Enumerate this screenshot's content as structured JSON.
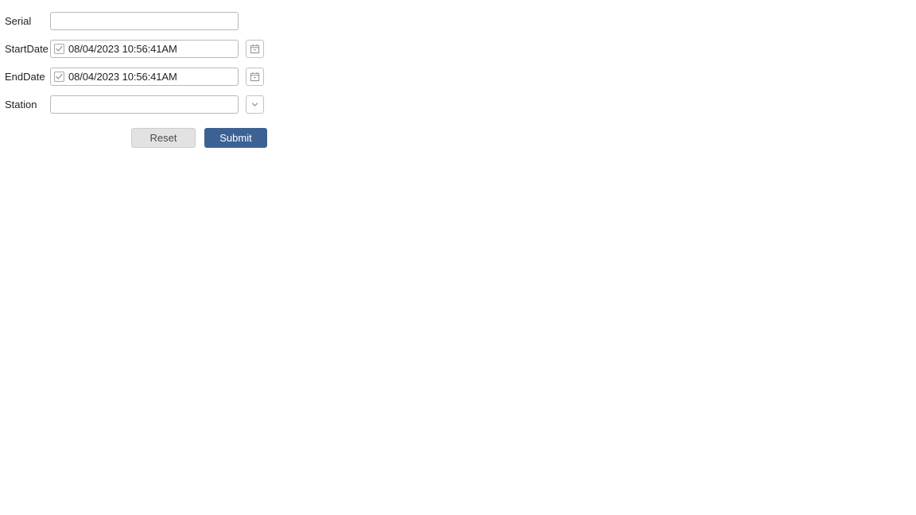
{
  "form": {
    "fields": [
      {
        "key": "serial",
        "label": "Serial",
        "type": "text",
        "value": "",
        "placeholder": ""
      },
      {
        "key": "startdate",
        "label": "StartDate",
        "type": "datetime",
        "value": "08/04/2023 10:56:41AM",
        "checked": true,
        "trailing_icon": "calendar-icon"
      },
      {
        "key": "enddate",
        "label": "EndDate",
        "type": "datetime",
        "value": "08/04/2023 10:56:41AM",
        "checked": true,
        "trailing_icon": "calendar-icon"
      },
      {
        "key": "station",
        "label": "Station",
        "type": "select",
        "value": "",
        "placeholder": "",
        "trailing_icon": "chevron-down-icon"
      }
    ],
    "actions": {
      "reset_label": "Reset",
      "submit_label": "Submit"
    }
  },
  "colors": {
    "submit_bg": "#3c6294",
    "submit_text": "#ffffff",
    "reset_bg": "#e2e2e2",
    "reset_text": "#4a4a4a",
    "input_border": "#b8b8b8",
    "label_text": "#222222",
    "page_bg": "#ffffff"
  }
}
